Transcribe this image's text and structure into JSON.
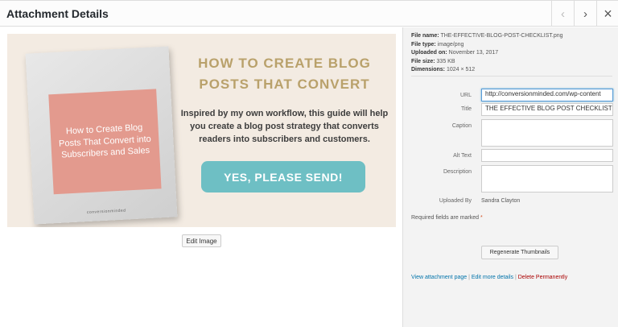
{
  "header": {
    "title": "Attachment Details",
    "prev_icon": "‹",
    "next_icon": "›",
    "close_icon": "×"
  },
  "preview": {
    "book_title": "How to Create Blog Posts That Convert into Subscribers and Sales",
    "book_brand": "conversionminded",
    "promo_title": "HOW TO CREATE BLOG POSTS THAT CONVERT",
    "promo_text": "Inspired by my own workflow, this guide will help you create a blog post strategy that converts readers into subscribers and customers.",
    "cta_label": "YES, PLEASE SEND!",
    "edit_image_label": "Edit Image"
  },
  "meta": {
    "file_name_label": "File name:",
    "file_name": "THE-EFFECTIVE-BLOG-POST-CHECKLIST.png",
    "file_type_label": "File type:",
    "file_type": "image/png",
    "uploaded_on_label": "Uploaded on:",
    "uploaded_on": "November 13, 2017",
    "file_size_label": "File size:",
    "file_size": "335 KB",
    "dimensions_label": "Dimensions:",
    "dimensions": "1024 × 512"
  },
  "fields": {
    "url_label": "URL",
    "url_value": "http://conversionminded.com/wp-content",
    "title_label": "Title",
    "title_value": "THE EFFECTIVE BLOG POST CHECKLIST",
    "caption_label": "Caption",
    "caption_value": "",
    "alt_label": "Alt Text",
    "alt_value": "",
    "description_label": "Description",
    "description_value": "",
    "uploaded_by_label": "Uploaded By",
    "uploaded_by_value": "Sandra Clayton"
  },
  "required_note": "Required fields are marked",
  "required_star": "*",
  "regenerate_label": "Regenerate Thumbnails",
  "links": {
    "view": "View attachment page",
    "edit": "Edit more details",
    "delete": "Delete Permanently",
    "separator": "|"
  }
}
